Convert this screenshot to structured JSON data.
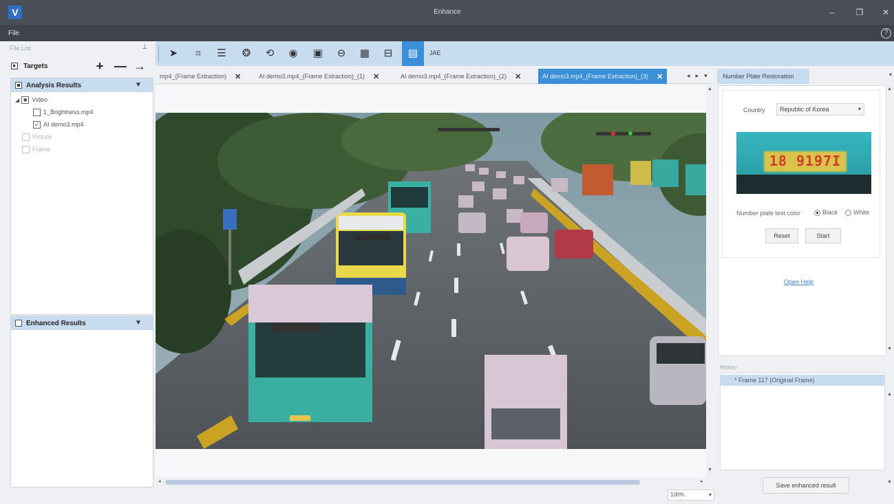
{
  "app": {
    "title": "Enhance",
    "logo": "V"
  },
  "window_controls": {
    "minimize": "–",
    "maximize": "❐",
    "close": "✕"
  },
  "menu": {
    "file": "File",
    "help_icon": "?"
  },
  "left_panel": {
    "file_list_label": "File List",
    "pin_icon": "⊥",
    "targets_label": "Targets",
    "add_icon": "+",
    "remove_icon": "—",
    "import_icon": "→",
    "analysis_results": {
      "label": "Analysis Results",
      "tree": [
        {
          "label": "Video",
          "checked": "■",
          "level": 0
        },
        {
          "label": "1_Brightness.mp4",
          "checked": "",
          "level": 1
        },
        {
          "label": "AI demo3.mp4",
          "checked": "✓",
          "level": 1
        },
        {
          "label": "Picture",
          "checked": "",
          "level": 0
        },
        {
          "label": "Frame",
          "checked": "",
          "level": 0
        }
      ]
    },
    "enhanced_results": {
      "label": "Enhanced Results"
    }
  },
  "toolbar": {
    "tools": [
      {
        "icon": "select-arrow-icon",
        "glyph": "➤"
      },
      {
        "icon": "crop-icon",
        "glyph": "⌗"
      },
      {
        "icon": "adjust-icon",
        "glyph": "☰"
      },
      {
        "icon": "stabilize-icon",
        "glyph": "❂"
      },
      {
        "icon": "rotate-icon",
        "glyph": "⟲"
      },
      {
        "icon": "focus-icon",
        "glyph": "◉"
      },
      {
        "icon": "frame-icon",
        "glyph": "▣"
      },
      {
        "icon": "deblur-icon",
        "glyph": "⊖"
      },
      {
        "icon": "mosaic-icon",
        "glyph": "▦"
      },
      {
        "icon": "compare-icon",
        "glyph": "⊟"
      },
      {
        "icon": "plate-icon",
        "glyph": "▤"
      }
    ],
    "extra_label": "JAE"
  },
  "tabs": [
    {
      "label": "mp4_(Frame Extraction)",
      "active": false
    },
    {
      "label": "AI demo3.mp4_(Frame Extraction)_(1)",
      "active": false
    },
    {
      "label": "AI demo3.mp4_(Frame Extraction)_(2)",
      "active": false
    },
    {
      "label": "AI demo3.mp4_(Frame Extraction)_(3)",
      "active": true
    }
  ],
  "tab_nav": {
    "prev": "◂",
    "next": "▸",
    "menu": "▾"
  },
  "viewer": {
    "zoom": "100%"
  },
  "right_panel": {
    "tab_label": "Number Plate Restoration",
    "country_label": "Country",
    "country_value": "Republic of Korea",
    "plate_text": "18 9197I",
    "text_color_label": "Number plate text color",
    "text_color_options": [
      {
        "label": "Black",
        "selected": true
      },
      {
        "label": "White",
        "selected": false
      }
    ],
    "reset_label": "Reset",
    "start_label": "Start",
    "open_help_label": "Open Help",
    "history_label": "History",
    "history_items": [
      "* Frame 117 (Original Frame)"
    ],
    "save_label": "Save enhanced result"
  },
  "colors": {
    "accent": "#3b8ed8",
    "header": "#4a4f57",
    "panel_head": "#c8dcf0"
  }
}
